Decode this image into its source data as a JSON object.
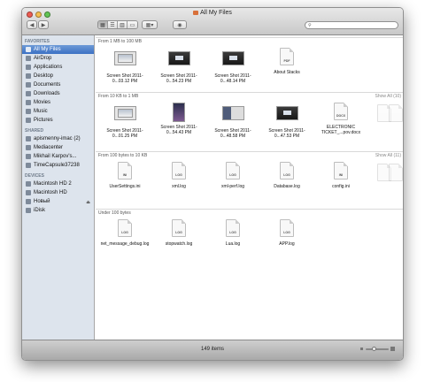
{
  "window": {
    "title": "All My Files",
    "status": "149 items"
  },
  "toolbar": {
    "back_icon": "chevron-left-icon",
    "forward_icon": "chevron-right-icon",
    "view_icons": [
      "icon-view-icon",
      "list-view-icon",
      "column-view-icon",
      "coverflow-view-icon"
    ],
    "arrange_icon": "arrange-grid-icon",
    "quicklook_icon": "eye-icon",
    "search_placeholder": ""
  },
  "sidebar": {
    "favorites_header": "FAVORITES",
    "favorites": [
      {
        "label": "All My Files",
        "icon": "all-files-icon",
        "selected": true
      },
      {
        "label": "AirDrop",
        "icon": "airdrop-icon"
      },
      {
        "label": "Applications",
        "icon": "applications-icon"
      },
      {
        "label": "Desktop",
        "icon": "desktop-icon"
      },
      {
        "label": "Documents",
        "icon": "documents-icon"
      },
      {
        "label": "Downloads",
        "icon": "downloads-icon"
      },
      {
        "label": "Movies",
        "icon": "movies-icon"
      },
      {
        "label": "Music",
        "icon": "music-icon"
      },
      {
        "label": "Pictures",
        "icon": "pictures-icon"
      }
    ],
    "shared_header": "SHARED",
    "shared": [
      {
        "label": "apismenny-imac (2)",
        "icon": "imac-icon"
      },
      {
        "label": "Mediacenter",
        "icon": "pc-icon"
      },
      {
        "label": "Mikhail Karpov's...",
        "icon": "macbook-icon"
      },
      {
        "label": "TimeCapsule37238",
        "icon": "timecapsule-icon"
      }
    ],
    "devices_header": "DEVICES",
    "devices": [
      {
        "label": "Macintosh HD 2",
        "icon": "hard-drive-icon"
      },
      {
        "label": "Macintosh HD",
        "icon": "hard-drive-icon"
      },
      {
        "label": "Новый",
        "icon": "hard-drive-icon",
        "eject": "⏏"
      },
      {
        "label": "iDisk",
        "icon": "idisk-icon"
      }
    ]
  },
  "sections": [
    {
      "title": "From 1 MB to 100 MB",
      "show_all": "",
      "files": [
        {
          "name": "Screen Shot 2011-0...03.12 PM",
          "kind": "shot-win"
        },
        {
          "name": "Screen Shot 2011-0...54.23 PM",
          "kind": "shot-dark"
        },
        {
          "name": "Screen Shot 2011-0...48.14 PM",
          "kind": "shot-dark"
        },
        {
          "name": "About Stacks",
          "kind": "doc",
          "tag": "PDF"
        }
      ]
    },
    {
      "title": "From 10 KB to 1 MB",
      "show_all": "Show All (10)",
      "files": [
        {
          "name": "Screen Shot 2011-0...01.25 PM",
          "kind": "shot-win"
        },
        {
          "name": "Screen Shot 2011-0...54.43 PM",
          "kind": "shot-tall"
        },
        {
          "name": "Screen Shot 2011-0...48.58 PM",
          "kind": "shot-mix"
        },
        {
          "name": "Screen Shot 2011-0...47.53 PM",
          "kind": "shot-dark"
        },
        {
          "name": "ELECTRONIC TICKET_...pov.docx",
          "kind": "doc",
          "tag": "DOCX"
        }
      ]
    },
    {
      "title": "From 100 bytes to 10 KB",
      "show_all": "Show All (11)",
      "files": [
        {
          "name": "UserSettings.ini",
          "kind": "doc",
          "tag": "INI"
        },
        {
          "name": "xml.log",
          "kind": "doc",
          "tag": "LOG"
        },
        {
          "name": "xml-perf.log",
          "kind": "doc",
          "tag": "LOG"
        },
        {
          "name": "Database.log",
          "kind": "doc",
          "tag": "LOG"
        },
        {
          "name": "config.ini",
          "kind": "doc",
          "tag": "INI"
        }
      ]
    },
    {
      "title": "Under 100 bytes",
      "show_all": "",
      "files": [
        {
          "name": "net_message_debug.log",
          "kind": "doc",
          "tag": "LOG"
        },
        {
          "name": "stopwatch.log",
          "kind": "doc",
          "tag": "LOG"
        },
        {
          "name": "Lua.log",
          "kind": "doc",
          "tag": "LOG"
        },
        {
          "name": "APP.log",
          "kind": "doc",
          "tag": "LOG"
        }
      ]
    }
  ],
  "colors": {
    "sidebar_bg": "#dde4ed",
    "selection": "#3c71c4",
    "close": "#ee5c52",
    "minimize": "#f5be4f",
    "zoom": "#62c454"
  }
}
